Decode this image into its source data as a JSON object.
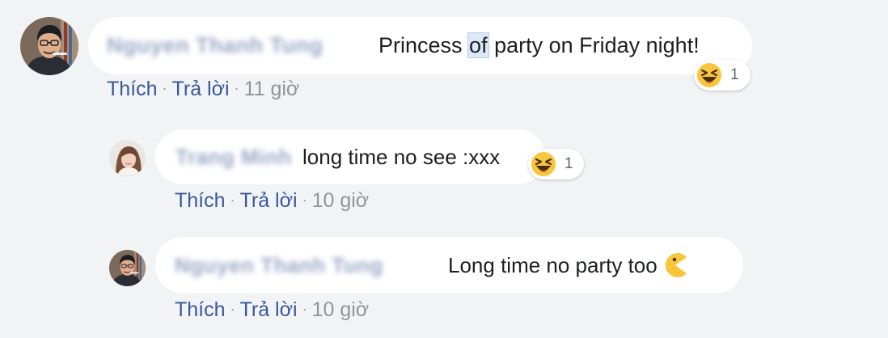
{
  "comments": [
    {
      "author": "Nguyen Thanh Tung",
      "text": "Princess ",
      "highlight": "of",
      "text_after": " party on Friday night!",
      "reaction": {
        "icon": "haha-emoji-icon",
        "count": "1"
      },
      "actions": {
        "like": "Thích",
        "reply": "Trả lời",
        "time": "11 giờ"
      }
    },
    {
      "author": "Trang Minh",
      "text": "long time no see :xxx",
      "reaction": {
        "icon": "haha-emoji-icon",
        "count": "1"
      },
      "actions": {
        "like": "Thích",
        "reply": "Trả lời",
        "time": "10 giờ"
      }
    },
    {
      "author": "Nguyen Thanh Tung",
      "text": "Long time no party too ",
      "emoji": "pacman-emoji-icon",
      "actions": {
        "like": "Thích",
        "reply": "Trả lời",
        "time": "10 giờ"
      }
    }
  ],
  "separator": "·",
  "colors": {
    "background": "#f2f3f5",
    "bubble": "#ffffff",
    "link": "#385898",
    "meta": "#90949c",
    "text": "#1c1e21",
    "emoji": "#f7c63c"
  }
}
